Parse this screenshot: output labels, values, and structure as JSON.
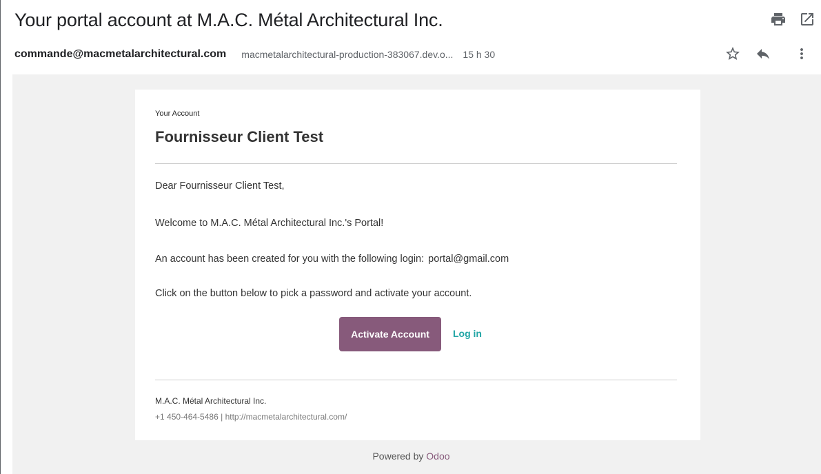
{
  "header": {
    "subject": "Your portal account at M.A.C. Métal Architectural Inc."
  },
  "top_icons": [
    "print-icon",
    "open-in-new-window-icon"
  ],
  "message_meta": {
    "sender": "commande@macmetalarchitectural.com",
    "recipient": "macmetalarchitectural-production-383067.dev.o...",
    "time": "15 h 30"
  },
  "row_icons": [
    "star-icon",
    "reply-icon",
    "more-vert-icon"
  ],
  "email": {
    "label": "Your Account",
    "title": "Fournisseur Client Test",
    "greeting": "Dear Fournisseur Client Test,",
    "welcome": "Welcome to M.A.C. Métal Architectural Inc.'s Portal!",
    "account_text": "An account has been created for you with the following login:",
    "login": "portal@gmail.com",
    "instructions": "Click on the button below to pick a password and activate your account.",
    "activate_label": "Activate Account",
    "login_link": "Log in",
    "footer_company": "M.A.C. Métal Architectural Inc.",
    "footer_phone": "+1 450-464-5486",
    "footer_separator": "|",
    "footer_site": "http://macmetalarchitectural.com/"
  },
  "powered": {
    "text": "Powered by",
    "brand": "Odoo"
  },
  "colors": {
    "button": "#875a7b",
    "link": "#21a5a5",
    "background": "#f1f1f1"
  }
}
